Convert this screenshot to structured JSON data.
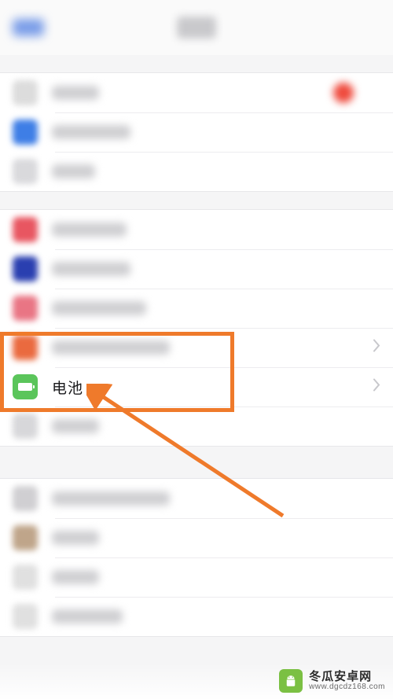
{
  "colors": {
    "accent_highlight": "#ef7a2b",
    "battery_icon_bg": "#5bc55b",
    "arrow": "#ef7a2b",
    "badge_red": "#ef4a3d"
  },
  "rows": {
    "battery": {
      "label": "电池"
    }
  },
  "watermark": {
    "name": "冬瓜安卓网",
    "url": "www.dgcdz168.com"
  },
  "annotation": {
    "type": "highlight-rectangle-with-arrow",
    "target": "battery-row"
  }
}
